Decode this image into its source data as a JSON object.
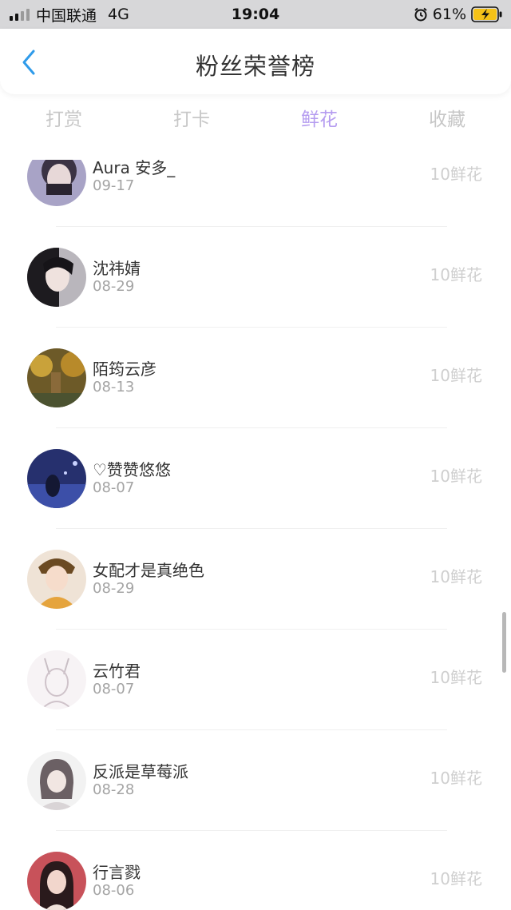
{
  "status_bar": {
    "carrier": "中国联通",
    "network": "4G",
    "time": "19:04",
    "battery": "61%",
    "alarm_icon": "alarm-clock-icon",
    "battery_icon": "battery-charging-icon"
  },
  "header": {
    "title": "粉丝荣誉榜",
    "back_icon": "chevron-left-icon"
  },
  "tabs": [
    {
      "label": "打赏",
      "active": false
    },
    {
      "label": "打卡",
      "active": false
    },
    {
      "label": "鲜花",
      "active": true
    },
    {
      "label": "收藏",
      "active": false
    }
  ],
  "colors": {
    "accent": "#b59cf0",
    "back": "#2f9bea"
  },
  "list": [
    {
      "name": "Aura 安多_",
      "date": "09-17",
      "count": "10鲜花"
    },
    {
      "name": "沈祎婧",
      "date": "08-29",
      "count": "10鲜花"
    },
    {
      "name": "陌筠云彦",
      "date": "08-13",
      "count": "10鲜花"
    },
    {
      "name": "♡赞赞悠悠",
      "date": "08-07",
      "count": "10鲜花"
    },
    {
      "name": "女配才是真绝色",
      "date": "08-29",
      "count": "10鲜花"
    },
    {
      "name": "云竹君",
      "date": "08-07",
      "count": "10鲜花"
    },
    {
      "name": "反派是草莓派",
      "date": "08-28",
      "count": "10鲜花"
    },
    {
      "name": "行言戮",
      "date": "08-06",
      "count": "10鲜花"
    }
  ]
}
